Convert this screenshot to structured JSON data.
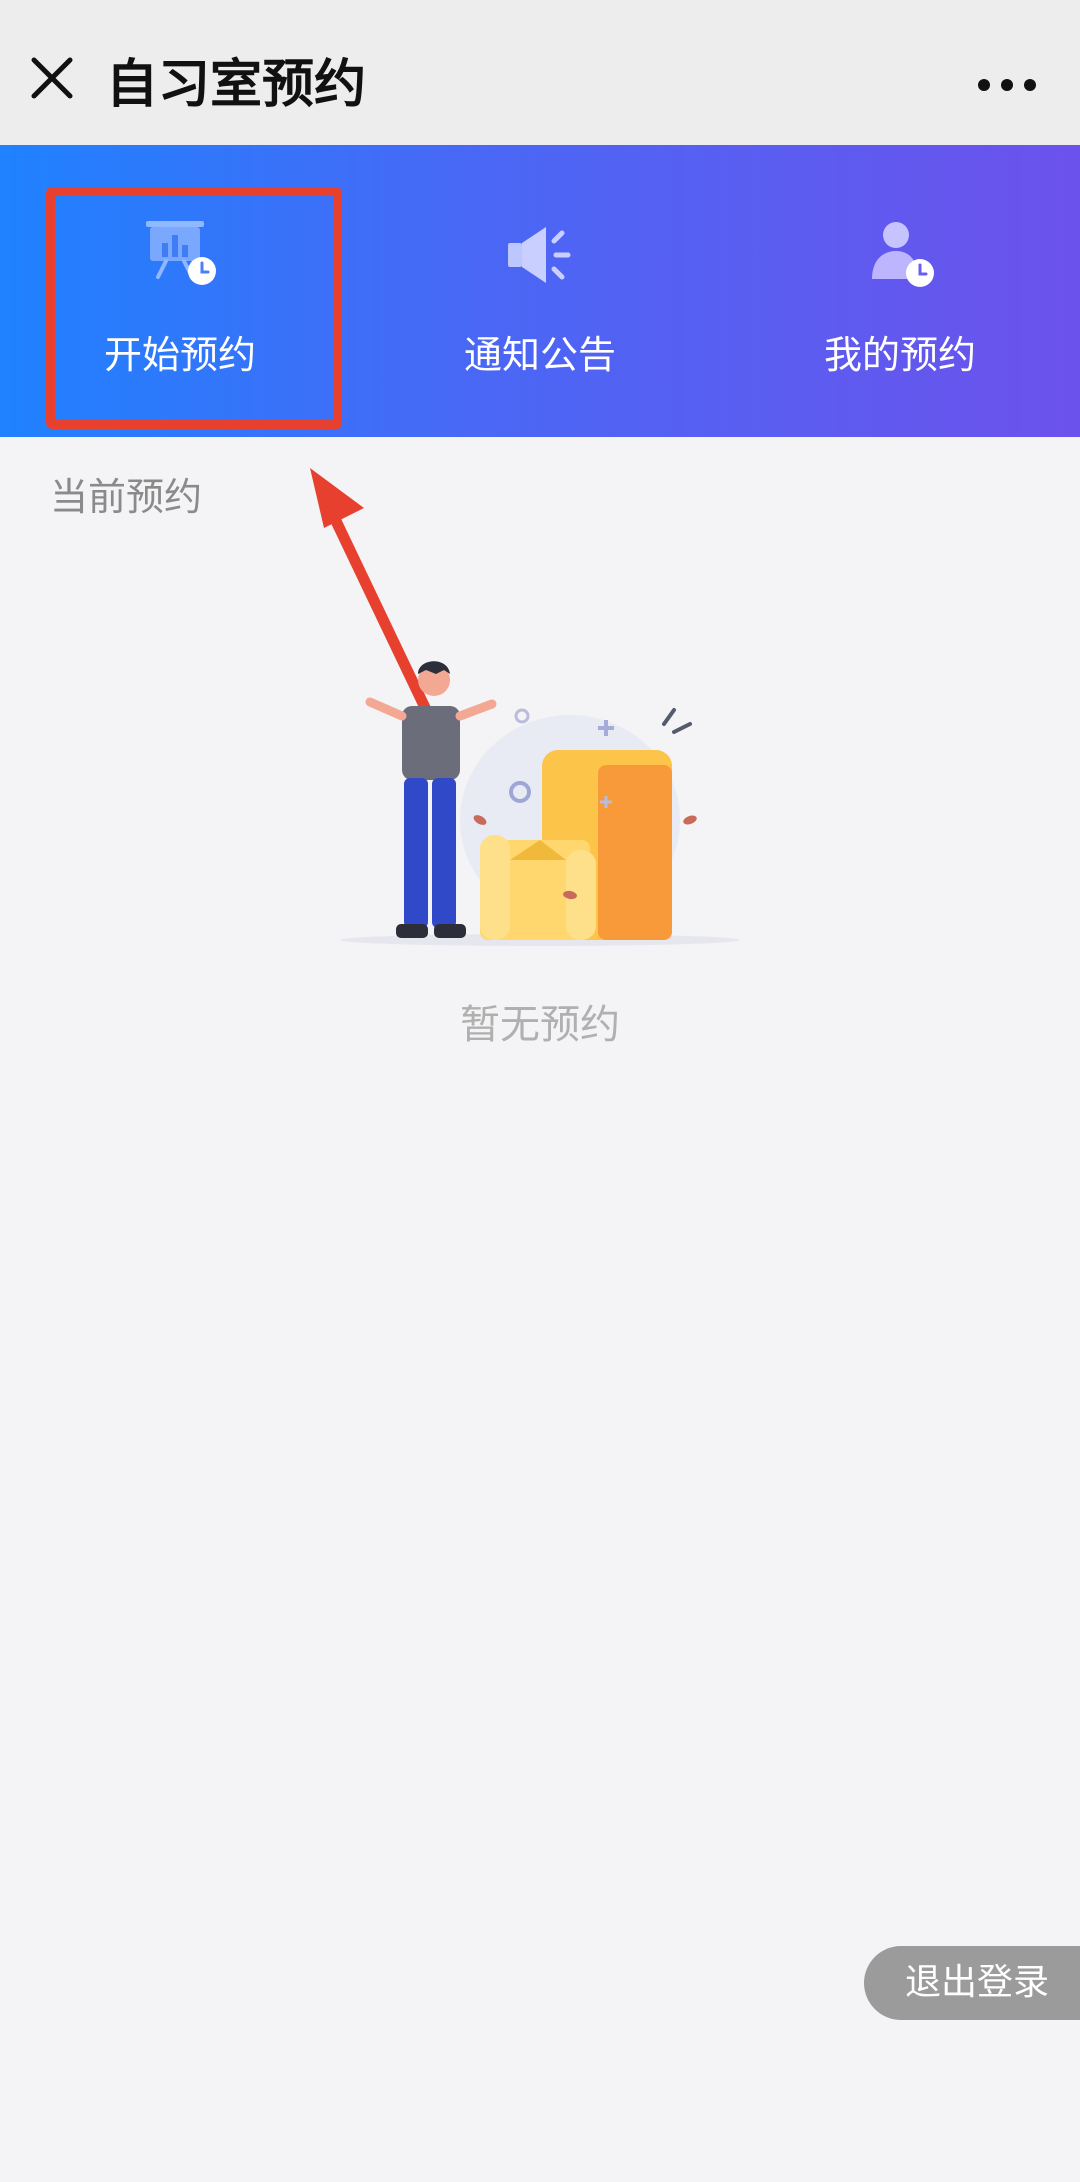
{
  "header": {
    "title": "自习室预约",
    "close_icon": "close-icon",
    "more_icon": "more-dots-icon"
  },
  "nav": {
    "items": [
      {
        "label": "开始预约",
        "icon": "presentation-clock-icon",
        "highlighted": true
      },
      {
        "label": "通知公告",
        "icon": "megaphone-icon",
        "highlighted": false
      },
      {
        "label": "我的预约",
        "icon": "user-clock-icon",
        "highlighted": false
      }
    ]
  },
  "main": {
    "section_title": "当前预约",
    "empty_text": "暂无预约"
  },
  "footer": {
    "logout_label": "退出登录"
  },
  "colors": {
    "banner_start": "#1f82ff",
    "banner_end": "#6c52ec",
    "highlight": "#e8402f"
  }
}
